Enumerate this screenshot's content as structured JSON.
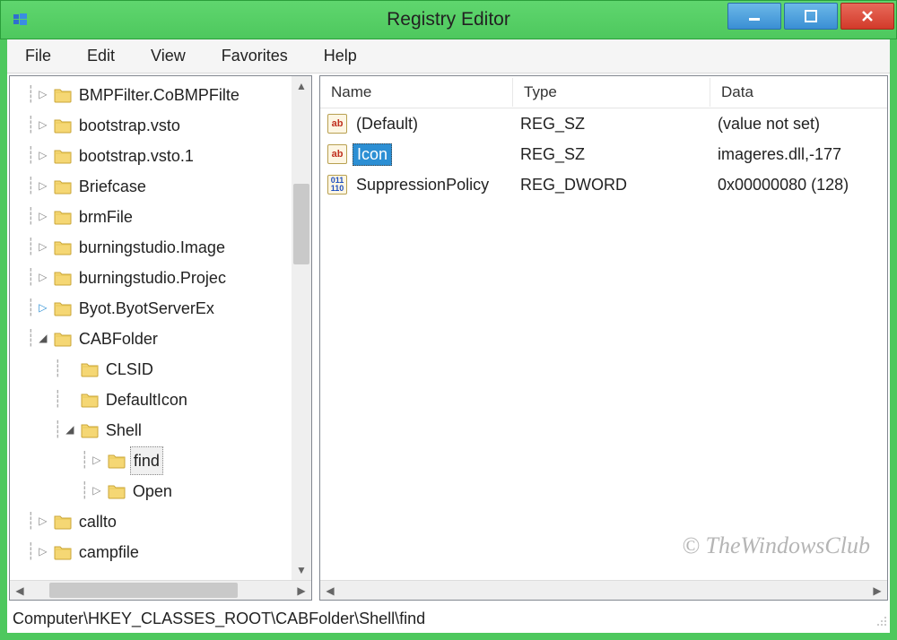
{
  "titlebar": {
    "title": "Registry Editor"
  },
  "menubar": {
    "items": [
      "File",
      "Edit",
      "View",
      "Favorites",
      "Help"
    ]
  },
  "tree": {
    "items": [
      {
        "indent": 0,
        "expander": "closed",
        "label": "BMPFilter.CoBMPFilte"
      },
      {
        "indent": 0,
        "expander": "closed",
        "label": "bootstrap.vsto"
      },
      {
        "indent": 0,
        "expander": "closed",
        "label": "bootstrap.vsto.1"
      },
      {
        "indent": 0,
        "expander": "closed",
        "label": "Briefcase"
      },
      {
        "indent": 0,
        "expander": "closed",
        "label": "brmFile"
      },
      {
        "indent": 0,
        "expander": "closed",
        "label": "burningstudio.Image"
      },
      {
        "indent": 0,
        "expander": "closed",
        "label": "burningstudio.Projec"
      },
      {
        "indent": 0,
        "expander": "blue",
        "label": "Byot.ByotServerEx"
      },
      {
        "indent": 0,
        "expander": "open",
        "label": "CABFolder"
      },
      {
        "indent": 1,
        "expander": "none",
        "label": "CLSID"
      },
      {
        "indent": 1,
        "expander": "none",
        "label": "DefaultIcon"
      },
      {
        "indent": 1,
        "expander": "open",
        "label": "Shell"
      },
      {
        "indent": 2,
        "expander": "closed",
        "label": "find",
        "selected": true
      },
      {
        "indent": 2,
        "expander": "closed",
        "label": "Open"
      },
      {
        "indent": 0,
        "expander": "closed",
        "label": "callto"
      },
      {
        "indent": 0,
        "expander": "closed",
        "label": "campfile"
      }
    ]
  },
  "list": {
    "headers": {
      "name": "Name",
      "type": "Type",
      "data": "Data"
    },
    "rows": [
      {
        "icon": "sz",
        "name": "(Default)",
        "type": "REG_SZ",
        "data": "(value not set)",
        "selected": false
      },
      {
        "icon": "sz",
        "name": "Icon",
        "type": "REG_SZ",
        "data": "imageres.dll,-177",
        "selected": true
      },
      {
        "icon": "dw",
        "name": "SuppressionPolicy",
        "type": "REG_DWORD",
        "data": "0x00000080 (128)",
        "selected": false
      }
    ]
  },
  "statusbar": {
    "path": "Computer\\HKEY_CLASSES_ROOT\\CABFolder\\Shell\\find"
  },
  "watermark": "© TheWindowsClub"
}
